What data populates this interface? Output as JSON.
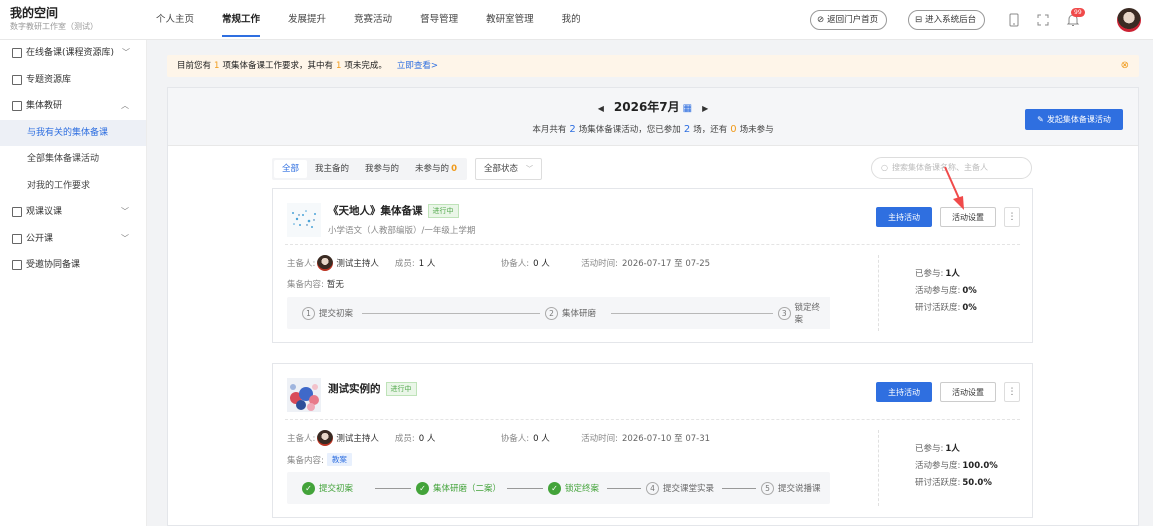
{
  "brand": {
    "title": "我的空间",
    "subtitle": "数字教研工作室（测试）"
  },
  "nav": [
    "个人主页",
    "常规工作",
    "发展提升",
    "竞赛活动",
    "督导管理",
    "教研室管理",
    "我的"
  ],
  "header_buttons": {
    "portal": "返回门户首页",
    "admin": "进入系统后台",
    "badge": "99"
  },
  "sidebar": {
    "items": [
      {
        "label": "在线备课(课程资源库)",
        "chevron": "﹀"
      },
      {
        "label": "专题资源库"
      },
      {
        "label": "集体教研",
        "chevron": "︿"
      },
      {
        "label": "观课议课",
        "chevron": "﹀"
      },
      {
        "label": "公开课",
        "chevron": "﹀"
      },
      {
        "label": "受邀协同备课"
      }
    ],
    "sub": [
      "与我有关的集体备课",
      "全部集体备课活动",
      "对我的工作要求"
    ]
  },
  "notice": {
    "p1": "目前您有",
    "n1": "1",
    "p2": "项集体备课工作要求，其中有",
    "n2": "1",
    "p3": "项未完成。",
    "link": "立即查看>"
  },
  "month": {
    "title": "2026年7月",
    "s1": "本月共有",
    "n1": "2",
    "s2": "场集体备课活动，您已参加",
    "n2": "2",
    "s3": "场，还有",
    "n3": "0",
    "s4": "场未参与",
    "launch": "发起集体备课活动"
  },
  "filters": {
    "tabs": [
      "全部",
      "我主备的",
      "我参与的",
      "未参与的"
    ],
    "unjoined_count": "0",
    "status": "全部状态",
    "search_placeholder": "搜索集体备课名称、主备人"
  },
  "card_labels": {
    "host": "主备人:",
    "members": "成员:",
    "assist": "协备人:",
    "time": "活动时间:",
    "content": "集备内容:",
    "btn_host": "主持活动",
    "btn_set": "活动设置",
    "joined": "已参与:",
    "participation": "活动参与度:",
    "activity": "研讨活跃度:"
  },
  "cards": [
    {
      "title": "《天地人》集体备课",
      "status": "进行中",
      "subject": "小学语文（人教部编版）/一年级上学期",
      "host_name": "测试主持人",
      "members": "1 人",
      "assistants": "0 人",
      "time": "2026-07-17 至 07-25",
      "content": "暂无",
      "steps": [
        {
          "n": "1",
          "label": "提交初案",
          "done": false
        },
        {
          "n": "2",
          "label": "集体研磨",
          "done": false
        },
        {
          "n": "3",
          "label": "锁定终案",
          "done": false
        }
      ],
      "joined": "1人",
      "participation": "0%",
      "activity": "0%"
    },
    {
      "title": "测试实例的",
      "status": "进行中",
      "subject": "",
      "host_name": "测试主持人",
      "members": "0 人",
      "assistants": "0 人",
      "time": "2026-07-10 至 07-31",
      "content_tag": "教案",
      "steps": [
        {
          "n": "1",
          "label": "提交初案",
          "done": true
        },
        {
          "n": "2",
          "label": "集体研磨（二案）",
          "done": true
        },
        {
          "n": "3",
          "label": "锁定终案",
          "done": true
        },
        {
          "n": "4",
          "label": "提交课堂实录",
          "done": false
        },
        {
          "n": "5",
          "label": "提交说播课",
          "done": false
        }
      ],
      "joined": "1人",
      "participation": "100.0%",
      "activity": "50.0%"
    }
  ],
  "colors": {
    "accent": "#2f6fe0",
    "warning": "#f09a1a",
    "success": "#43a33a",
    "annotation_arrow": "#f04a4a"
  }
}
